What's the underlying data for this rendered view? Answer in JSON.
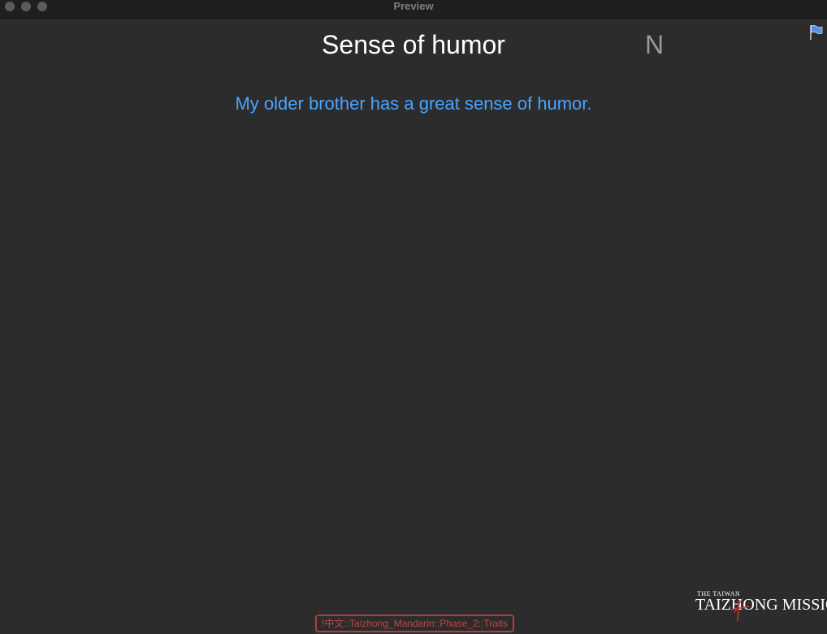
{
  "window": {
    "title": "Preview"
  },
  "card": {
    "title": "Sense of humor",
    "letter": "N",
    "sentence": "My older brother has a great sense of humor.",
    "tag": "!中文::Taizhong_Mandarin::Phase_2::Traits"
  },
  "logo": {
    "small_text": "THE TAIWAN",
    "main_text": "TAIZHONG MISSION"
  },
  "icons": {
    "flag": "flag-icon",
    "flag_color": "#5a8ee8"
  },
  "colors": {
    "background": "#2c2c2c",
    "title": "#ffffff",
    "sentence": "#4aa3ff",
    "letter": "#9a9a9a",
    "tag": "#c24545",
    "logo_accent": "#c0392b"
  }
}
